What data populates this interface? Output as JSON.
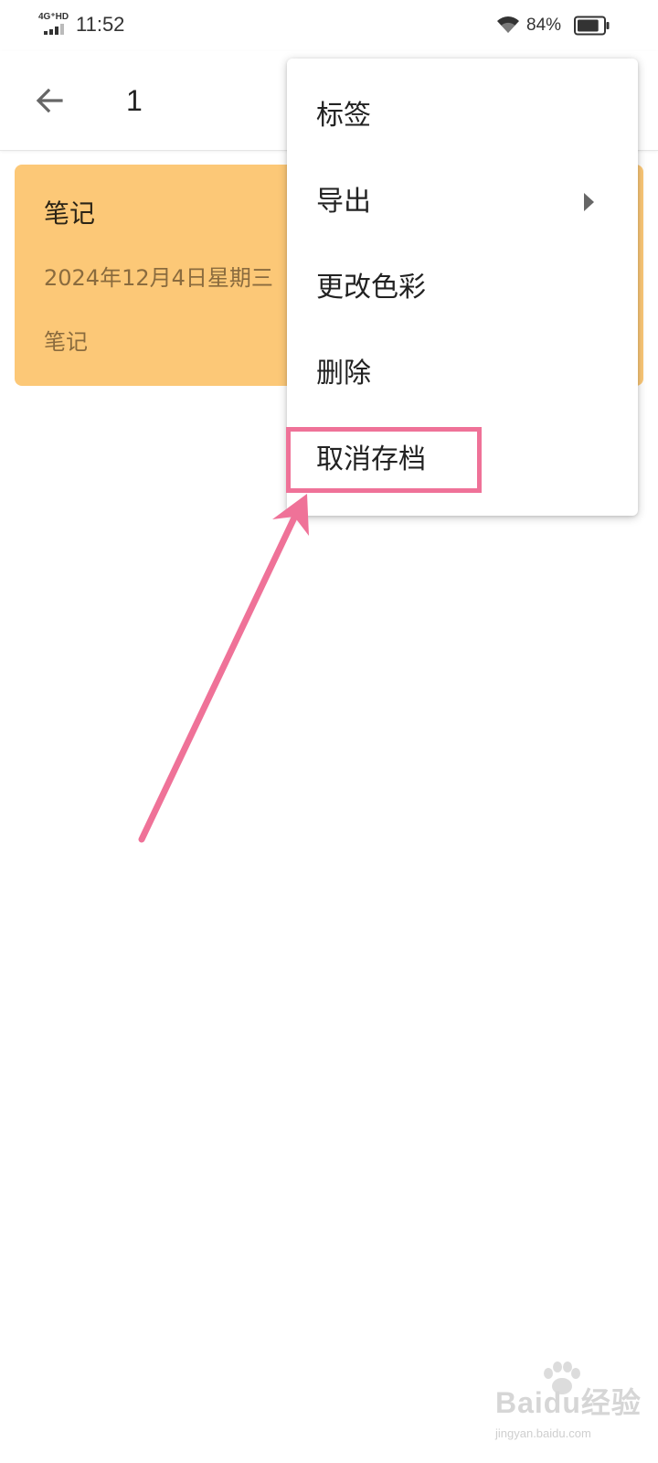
{
  "status_bar": {
    "network_label": "4G⁺HD",
    "time": "11:52",
    "battery_percent": "84%",
    "battery_level": 0.84
  },
  "app_bar": {
    "back_icon": "arrow-back-icon",
    "title": "1"
  },
  "note_card": {
    "title": "笔记",
    "date": "2024年12月4日星期三",
    "tag": "笔记",
    "background_color": "#fcc877"
  },
  "popup_menu": {
    "items": [
      {
        "label": "标签",
        "has_submenu": false
      },
      {
        "label": "导出",
        "has_submenu": true
      },
      {
        "label": "更改色彩",
        "has_submenu": false
      },
      {
        "label": "删除",
        "has_submenu": false
      },
      {
        "label": "取消存档",
        "has_submenu": false
      }
    ]
  },
  "annotation": {
    "highlight_color": "#ef7298",
    "arrow_color": "#ef7298"
  },
  "watermark": {
    "logo_text": "Baidu经验",
    "url": "jingyan.baidu.com"
  }
}
